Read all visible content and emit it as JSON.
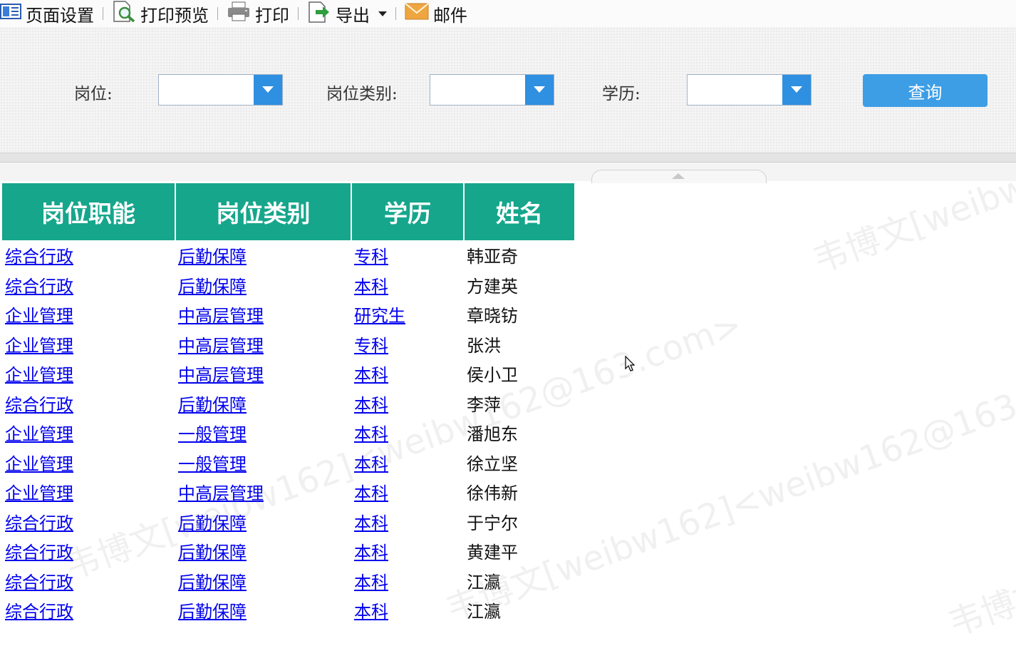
{
  "toolbar": {
    "items": [
      {
        "label": "页面设置",
        "icon": "page-setup-icon"
      },
      {
        "label": "打印预览",
        "icon": "print-preview-icon"
      },
      {
        "label": "打印",
        "icon": "printer-icon"
      },
      {
        "label": "导出",
        "icon": "export-icon"
      },
      {
        "label": "邮件",
        "icon": "mail-icon"
      }
    ]
  },
  "filters": {
    "position_label": "岗位:",
    "position_value": "",
    "category_label": "岗位类别:",
    "category_value": "",
    "education_label": "学历:",
    "education_value": "",
    "query_label": "查询"
  },
  "table": {
    "headers": [
      "岗位职能",
      "岗位类别",
      "学历",
      "姓名"
    ],
    "rows": [
      [
        "综合行政",
        "后勤保障",
        "专科",
        "韩亚奇"
      ],
      [
        "综合行政",
        "后勤保障",
        "本科",
        "方建英"
      ],
      [
        "企业管理",
        "中高层管理",
        "研究生",
        "章晓钫"
      ],
      [
        "企业管理",
        "中高层管理",
        "专科",
        "张洪"
      ],
      [
        "企业管理",
        "中高层管理",
        "本科",
        "侯小卫"
      ],
      [
        "综合行政",
        "后勤保障",
        "本科",
        "李萍"
      ],
      [
        "企业管理",
        "一般管理",
        "本科",
        "潘旭东"
      ],
      [
        "企业管理",
        "一般管理",
        "本科",
        "徐立坚"
      ],
      [
        "企业管理",
        "中高层管理",
        "本科",
        "徐伟新"
      ],
      [
        "综合行政",
        "后勤保障",
        "本科",
        "于宁尔"
      ],
      [
        "综合行政",
        "后勤保障",
        "本科",
        "黄建平"
      ],
      [
        "综合行政",
        "后勤保障",
        "本科",
        "江瀛"
      ],
      [
        "综合行政",
        "后勤保障",
        "本科",
        "江瀛"
      ]
    ]
  },
  "watermark": {
    "lines": [
      "韦博文[weibw162]<weibw162@163.com>",
      "韦博文[weibw162]<weibw162@163.com>",
      "韦博文[weibw162]<weibw162@163.com>",
      "韦博文[weibw162]<weibw162@163.com>"
    ]
  },
  "colors": {
    "header_bg": "#16a68c",
    "link": "#0000ee",
    "button": "#3d9ee6"
  }
}
